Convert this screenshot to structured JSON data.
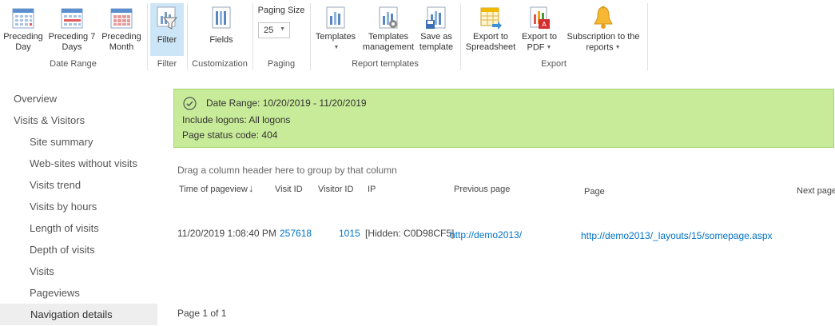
{
  "ribbon": {
    "date_range": {
      "label": "Date Range",
      "preceding_day": [
        "Preceding",
        "Day"
      ],
      "preceding_7_days": [
        "Preceding 7",
        "Days"
      ],
      "preceding_month": [
        "Preceding",
        "Month"
      ]
    },
    "filter": {
      "label": "Filter",
      "button": "Filter"
    },
    "customization": {
      "label": "Customization",
      "fields_button": "Fields"
    },
    "paging": {
      "title": "Paging Size",
      "size": "25",
      "label": "Paging"
    },
    "report_templates": {
      "label": "Report templates",
      "templates": "Templates",
      "templates_management": [
        "Templates",
        "management"
      ],
      "save_as_template": [
        "Save as",
        "template"
      ]
    },
    "export": {
      "label": "Export",
      "spreadsheet": [
        "Export to",
        "Spreadsheet"
      ],
      "pdf": [
        "Export to",
        "PDF"
      ],
      "subscription": [
        "Subscription to the",
        "reports"
      ]
    }
  },
  "nav": {
    "overview": "Overview",
    "visits_visitors": "Visits & Visitors",
    "items": [
      "Site summary",
      "Web-sites without visits",
      "Visits trend",
      "Visits by hours",
      "Length of visits",
      "Depth of visits",
      "Visits",
      "Pageviews",
      "Navigation details"
    ]
  },
  "banner": {
    "date_range": "Date Range: 10/20/2019 - 11/20/2019",
    "logons": "Include logons: All logons",
    "status_code": "Page status code: 404"
  },
  "grid": {
    "group_hint": "Drag a column header here to group by that column",
    "columns": {
      "time": "Time of pageview",
      "visit_id": "Visit ID",
      "visitor_id": "Visitor ID",
      "ip": "IP",
      "previous_page": "Previous page",
      "page": "Page",
      "next_page": "Next page"
    },
    "rows": [
      {
        "time": "11/20/2019 1:08:40 PM",
        "visit_id": "257618",
        "visitor_id": "1015",
        "ip": "[Hidden: C0D98CF5]",
        "previous_page": "http://demo2013/",
        "page": "http://demo2013/_layouts/15/somepage.aspx",
        "next_page": ""
      }
    ]
  },
  "pager": "Page 1 of 1"
}
